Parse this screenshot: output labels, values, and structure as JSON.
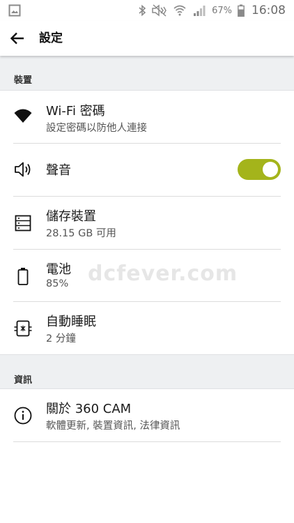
{
  "status_bar": {
    "battery_percent": "67%",
    "time": "16:08"
  },
  "app_bar": {
    "title": "設定",
    "back_icon": "arrow-left-icon"
  },
  "sections": [
    {
      "header": "裝置",
      "items": [
        {
          "title": "Wi-Fi 密碼",
          "subtitle": "設定密碼以防他人連接",
          "icon": "wifi-icon"
        },
        {
          "title": "聲音",
          "subtitle": "",
          "icon": "speaker-icon",
          "toggle": true
        },
        {
          "title": "儲存裝置",
          "subtitle": "28.15 GB 可用",
          "icon": "storage-icon"
        },
        {
          "title": "電池",
          "subtitle": "85%",
          "icon": "battery-icon"
        },
        {
          "title": "自動睡眠",
          "subtitle": "2 分鐘",
          "icon": "sleep-icon"
        }
      ]
    },
    {
      "header": "資訊",
      "items": [
        {
          "title": "關於 360 CAM",
          "subtitle": "軟體更新, 裝置資訊, 法律資訊",
          "icon": "info-icon"
        }
      ]
    }
  ],
  "watermark": "dcfever.com",
  "colors": {
    "toggle_on": "#a4b41b",
    "section_bg": "#eef0f2"
  }
}
